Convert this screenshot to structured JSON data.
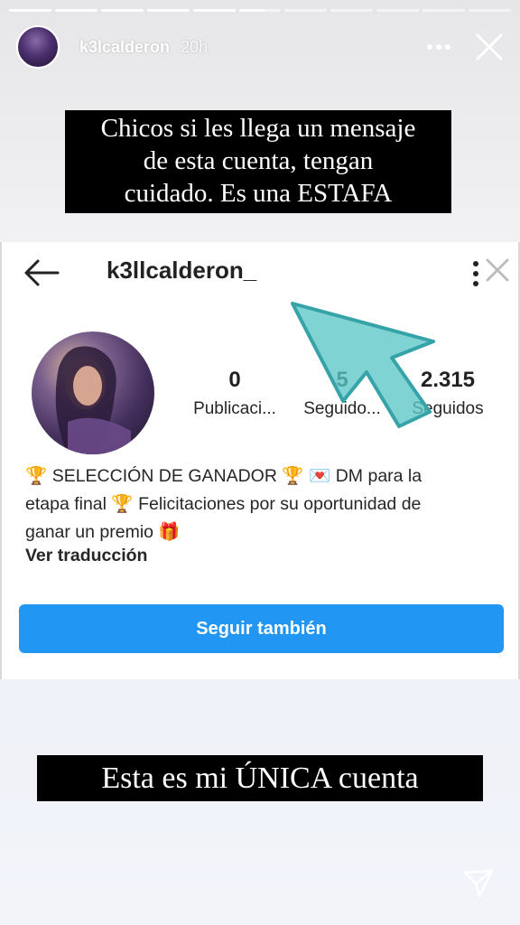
{
  "story": {
    "username": "k3lcalderon",
    "time": "20h",
    "progress": [
      1,
      1,
      1,
      1,
      1,
      0.6,
      0,
      0,
      0,
      0,
      0
    ]
  },
  "captions": {
    "top_line1": "Chicos si les llega un mensaje",
    "top_line2": "de esta cuenta, tengan",
    "top_line3": "cuidado. Es una ESTAFA",
    "bottom": "Esta es mi ÚNICA cuenta"
  },
  "profile": {
    "username": "k3llcalderon_",
    "stats": [
      {
        "value": "0",
        "label": "Publicaci..."
      },
      {
        "value": "5",
        "label": "Seguido..."
      },
      {
        "value": "2.315",
        "label": "Seguidos"
      }
    ],
    "bio_line1": "🏆 SELECCIÓN DE GANADOR 🏆 💌 DM para la",
    "bio_line2": "etapa final 🏆 Felicitaciones por su oportunidad de",
    "bio_line3": "ganar un premio 🎁",
    "see_translation": "Ver traducción",
    "follow_button": "Seguir también"
  },
  "colors": {
    "follow_button": "#2196f3",
    "arrow": "#5cc6c6",
    "caption_bg": "#000000"
  },
  "icons": [
    "more-icon",
    "close-icon",
    "back-arrow-icon",
    "kebab-icon",
    "arrow-pointer-icon",
    "send-icon"
  ]
}
